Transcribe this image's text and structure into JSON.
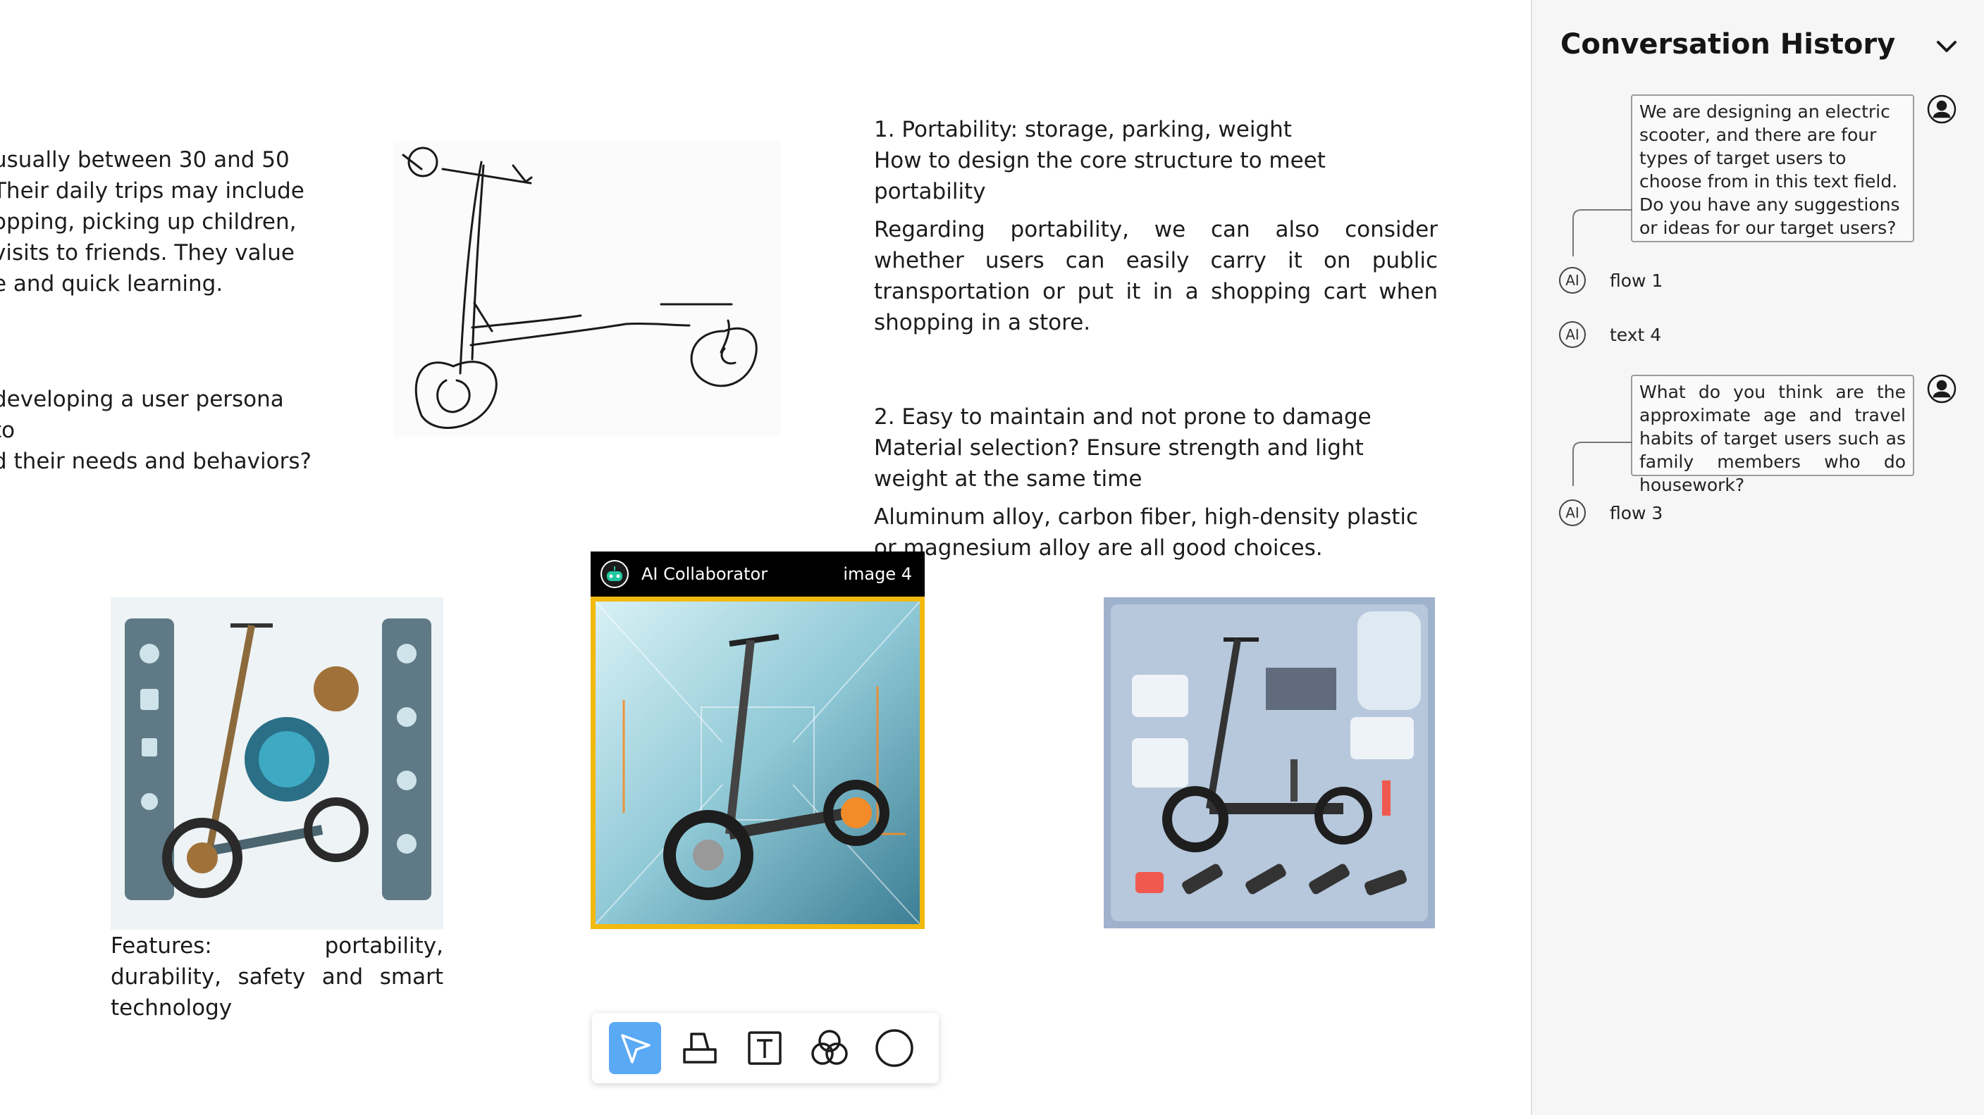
{
  "canvas": {
    "left_text_1": [
      "usually between 30 and 50",
      "Their daily trips may include",
      "opping, picking up children,",
      "visits to friends. They value",
      "e and quick learning."
    ],
    "left_text_2": [
      "developing a user persona to",
      "d their needs and behaviors?"
    ],
    "right_text": {
      "p1_title": "1. Portability: storage, parking, weight",
      "p1_sub": "How to design the core structure to meet portability",
      "p1_body": "Regarding portability, we can also consider whether users can easily carry it on public transportation or put it in a shopping cart when shopping in a store.",
      "p2_title": "2. Easy to maintain and not prone to damage",
      "p2_sub": "Material selection? Ensure strength and light weight at the same time",
      "p2_body": "Aluminum alloy, carbon fiber, high-density plastic or magnesium alloy are all good choices."
    },
    "caption_image1": "Features: portability, durability, safety and smart technology",
    "ai_collaborator": {
      "title": "AI Collaborator",
      "tag": "image 4"
    }
  },
  "toolbar": {
    "tools": [
      {
        "name": "select",
        "icon": "cursor-arrow-icon",
        "active": true
      },
      {
        "name": "shape",
        "icon": "shape-block-icon",
        "active": false
      },
      {
        "name": "text",
        "icon": "text-box-icon",
        "active": false
      },
      {
        "name": "blend",
        "icon": "overlap-circles-icon",
        "active": false
      },
      {
        "name": "circle",
        "icon": "circle-icon",
        "active": false
      }
    ]
  },
  "sidebar": {
    "title": "Conversation History",
    "items": [
      {
        "type": "user",
        "text": "We are designing an electric scooter, and there are four types of target users to choose from in this text field. Do you have any suggestions or ideas for our target users?"
      },
      {
        "type": "ai",
        "badge": "AI",
        "label": "flow 1"
      },
      {
        "type": "ai",
        "badge": "AI",
        "label": "text 4"
      },
      {
        "type": "user",
        "text": "What do you think are the approximate age and travel habits of target users such as family members who do housework?"
      },
      {
        "type": "ai",
        "badge": "AI",
        "label": "flow 3"
      }
    ]
  },
  "colors": {
    "accent_blue": "#5aa9f5",
    "highlight_yellow": "#f2b90f",
    "sidebar_bg": "#f6f6f6",
    "header_black": "#000000"
  }
}
